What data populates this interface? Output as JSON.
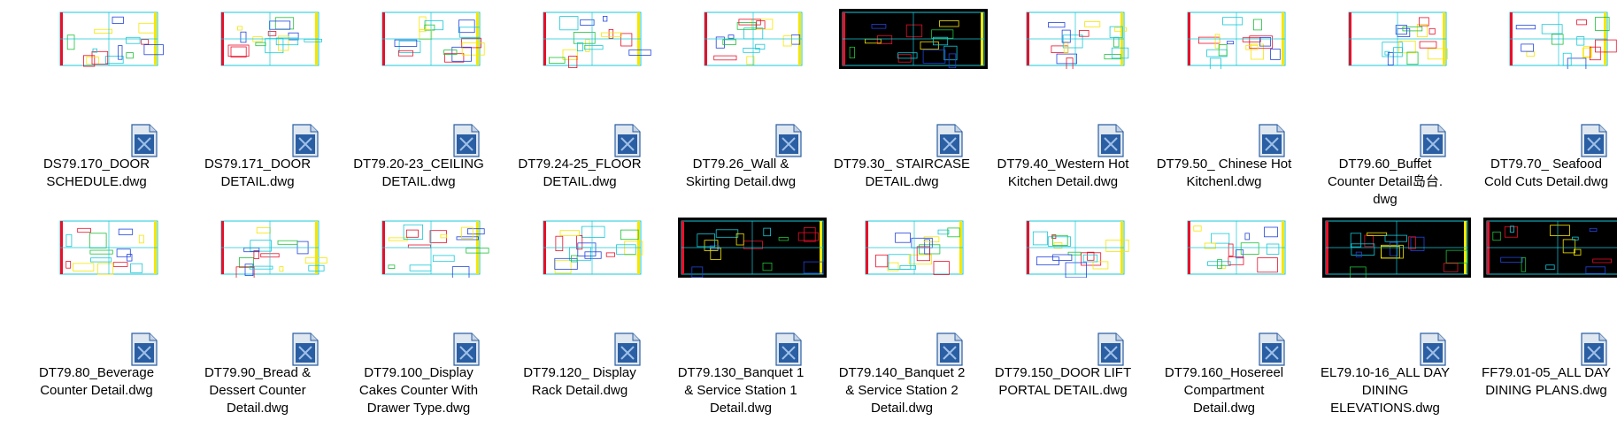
{
  "files": [
    {
      "name": "DS79.170_DOOR SCHEDULE.dwg",
      "line1": "DS79.170_DOOR",
      "line2": "SCHEDULE.dwg",
      "line3": "",
      "thumb_bg": "white",
      "thumb_icon": "dwg-drawing-thumbnail"
    },
    {
      "name": "DS79.171_DOOR DETAIL.dwg",
      "line1": "DS79.171_DOOR",
      "line2": "DETAIL.dwg",
      "line3": "",
      "thumb_bg": "white",
      "thumb_icon": "dwg-drawing-thumbnail"
    },
    {
      "name": "DT79.20-23_CEILING DETAIL.dwg",
      "line1": "DT79.20-23_CEILING",
      "line2": "DETAIL.dwg",
      "line3": "",
      "thumb_bg": "white",
      "thumb_icon": "dwg-drawing-thumbnail"
    },
    {
      "name": "DT79.24-25_FLOOR DETAIL.dwg",
      "line1": "DT79.24-25_FLOOR",
      "line2": "DETAIL.dwg",
      "line3": "",
      "thumb_bg": "white",
      "thumb_icon": "dwg-drawing-thumbnail"
    },
    {
      "name": "DT79.26_Wall & Skirting Detail.dwg",
      "line1": "DT79.26_Wall &",
      "line2": "Skirting Detail.dwg",
      "line3": "",
      "thumb_bg": "white",
      "thumb_icon": "dwg-drawing-thumbnail"
    },
    {
      "name": "DT79.30_ STAIRCASE DETAIL.dwg",
      "line1": "DT79.30_ STAIRCASE",
      "line2": "DETAIL.dwg",
      "line3": "",
      "thumb_bg": "black",
      "thumb_icon": "dwg-drawing-thumbnail"
    },
    {
      "name": "DT79.40_Western Hot Kitchen Detail.dwg",
      "line1": "DT79.40_Western Hot",
      "line2": "Kitchen Detail.dwg",
      "line3": "",
      "thumb_bg": "white",
      "thumb_icon": "dwg-drawing-thumbnail"
    },
    {
      "name": "DT79.50_ Chinese Hot Kitchenl.dwg",
      "line1": "DT79.50_ Chinese Hot",
      "line2": "Kitchenl.dwg",
      "line3": "",
      "thumb_bg": "white",
      "thumb_icon": "dwg-drawing-thumbnail"
    },
    {
      "name": "DT79.60_Buffet Counter Detail岛台.dwg",
      "line1": "DT79.60_Buffet",
      "line2": "Counter Detail岛台.",
      "line3": "dwg",
      "thumb_bg": "white",
      "thumb_icon": "dwg-drawing-thumbnail"
    },
    {
      "name": "DT79.70_ Seafood Cold Cuts Detail.dwg",
      "line1": "DT79.70_ Seafood",
      "line2": "Cold Cuts Detail.dwg",
      "line3": "",
      "thumb_bg": "white",
      "thumb_icon": "dwg-drawing-thumbnail"
    },
    {
      "name": "DT79.80_Beverage Counter Detail.dwg",
      "line1": "DT79.80_Beverage",
      "line2": "Counter Detail.dwg",
      "line3": "",
      "thumb_bg": "white",
      "thumb_icon": "dwg-drawing-thumbnail"
    },
    {
      "name": "DT79.90_Bread & Dessert Counter Detail.dwg",
      "line1": "DT79.90_Bread &",
      "line2": "Dessert Counter",
      "line3": "Detail.dwg",
      "thumb_bg": "white",
      "thumb_icon": "dwg-drawing-thumbnail"
    },
    {
      "name": "DT79.100_Display Cakes Counter With Drawer Type.dwg",
      "line1": "DT79.100_Display",
      "line2": "Cakes Counter With",
      "line3": "Drawer Type.dwg",
      "thumb_bg": "white",
      "thumb_icon": "dwg-drawing-thumbnail"
    },
    {
      "name": "DT79.120_ Display Rack Detail.dwg",
      "line1": "DT79.120_ Display",
      "line2": "Rack Detail.dwg",
      "line3": "",
      "thumb_bg": "white",
      "thumb_icon": "dwg-drawing-thumbnail"
    },
    {
      "name": "DT79.130_Banquet 1 & Service Station 1 Detail.dwg",
      "line1": "DT79.130_Banquet 1",
      "line2": "& Service Station 1",
      "line3": "Detail.dwg",
      "thumb_bg": "black",
      "thumb_icon": "dwg-drawing-thumbnail"
    },
    {
      "name": "DT79.140_Banquet 2 & Service Station 2 Detail.dwg",
      "line1": "DT79.140_Banquet 2",
      "line2": "& Service Station 2",
      "line3": "Detail.dwg",
      "thumb_bg": "white",
      "thumb_icon": "dwg-drawing-thumbnail"
    },
    {
      "name": "DT79.150_DOOR LIFT PORTAL DETAIL.dwg",
      "line1": "DT79.150_DOOR LIFT",
      "line2": "PORTAL DETAIL.dwg",
      "line3": "",
      "thumb_bg": "white",
      "thumb_icon": "dwg-drawing-thumbnail"
    },
    {
      "name": "DT79.160_Hosereel Compartment Detail.dwg",
      "line1": "DT79.160_Hosereel",
      "line2": "Compartment",
      "line3": "Detail.dwg",
      "thumb_bg": "white",
      "thumb_icon": "dwg-drawing-thumbnail"
    },
    {
      "name": "EL79.10-16_ALL DAY DINING ELEVATIONS.dwg",
      "line1": "EL79.10-16_ALL DAY",
      "line2": "DINING",
      "line3": "ELEVATIONS.dwg",
      "thumb_bg": "black",
      "thumb_icon": "dwg-drawing-thumbnail"
    },
    {
      "name": "FF79.01-05_ALL DAY DINING PLANS.dwg",
      "line1": "FF79.01-05_ALL DAY",
      "line2": "DINING  PLANS.dwg",
      "line3": "",
      "thumb_bg": "black",
      "thumb_icon": "dwg-drawing-thumbnail"
    }
  ],
  "colors": {
    "cad_red": "#e8102a",
    "cad_yellow": "#f6e600",
    "cad_cyan": "#15c8d8",
    "cad_blue": "#2244dd",
    "cad_green": "#1ec03a",
    "file_icon_blue": "#2b5fa3"
  }
}
